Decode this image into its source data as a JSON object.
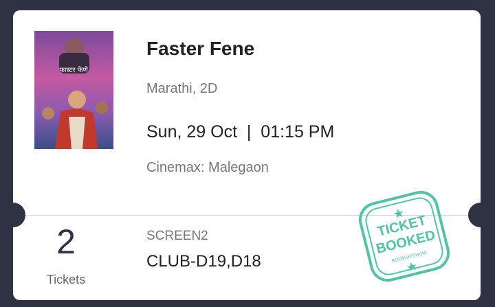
{
  "movie": {
    "title": "Faster Fene",
    "language_format": "Marathi, 2D",
    "showtime": "Sun, 29 Oct  |  01:15 PM",
    "cinema": "Cinemax: Malegaon",
    "poster_title_text": "फास्टर फेणे"
  },
  "booking": {
    "ticket_count": "2",
    "ticket_count_label": "Tickets",
    "screen": "SCREEN2",
    "seats": "CLUB-D19,D18"
  },
  "stamp": {
    "line1": "TICKET",
    "line2": "BOOKED",
    "brand": "BOOKMYSHOW"
  },
  "colors": {
    "background": "#2f3242",
    "card": "#ffffff",
    "stamp": "#4fc4a6",
    "ticket_count": "#2f3347"
  }
}
